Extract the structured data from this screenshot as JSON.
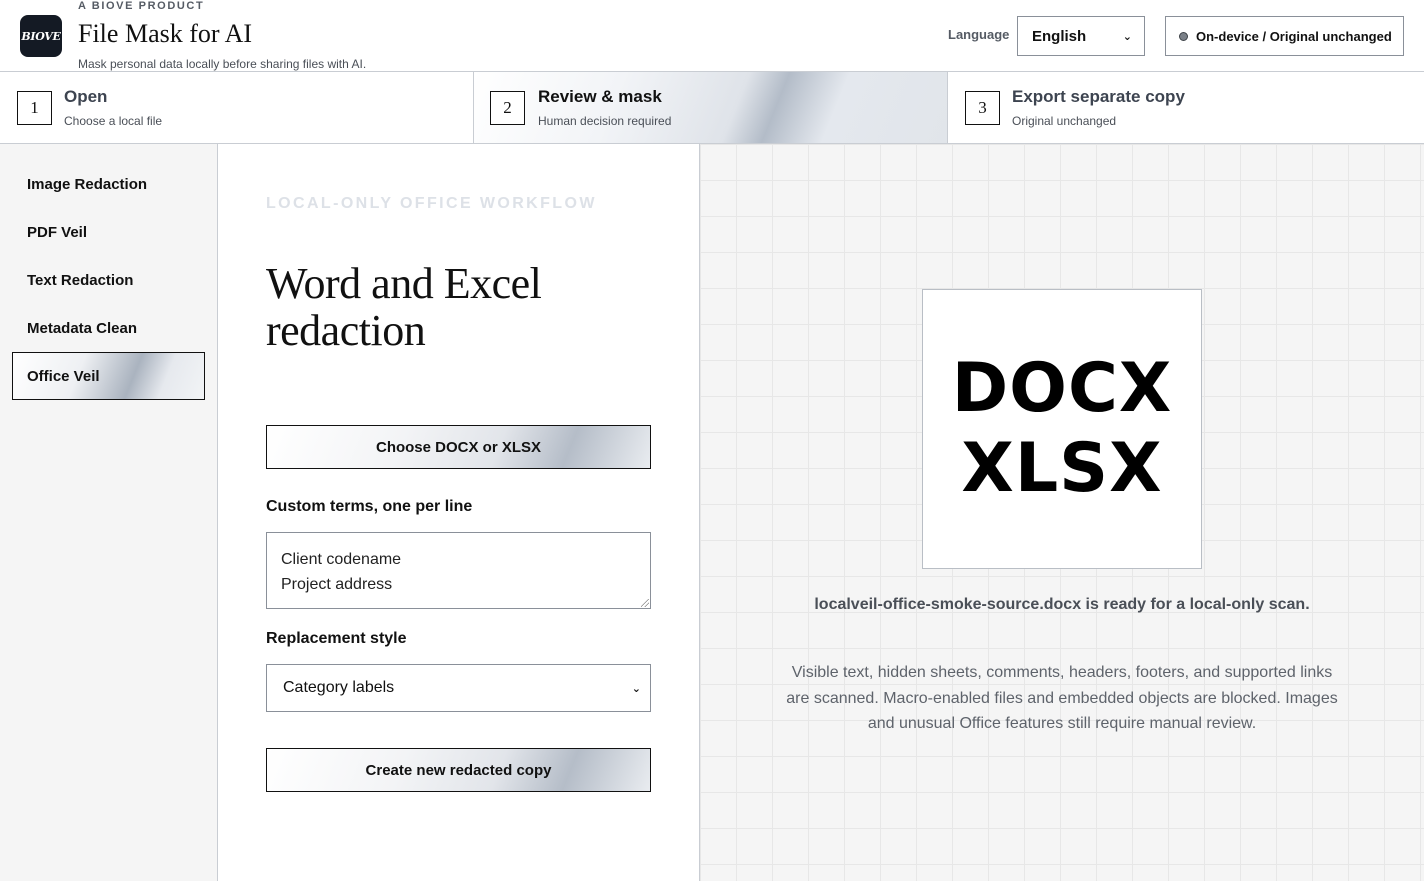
{
  "header": {
    "logo_text": "BIOVE",
    "kicker": "A BIOVE PRODUCT",
    "title": "File Mask for AI",
    "subtitle": "Mask personal data locally before sharing files with AI.",
    "language_label": "Language",
    "language_value": "English",
    "status": "On-device / Original unchanged"
  },
  "steps": [
    {
      "number": "1",
      "title": "Open",
      "subtitle": "Choose a local file"
    },
    {
      "number": "2",
      "title": "Review & mask",
      "subtitle": "Human decision required"
    },
    {
      "number": "3",
      "title": "Export separate copy",
      "subtitle": "Original unchanged"
    }
  ],
  "sidebar": {
    "items": [
      {
        "label": "Image Redaction"
      },
      {
        "label": "PDF Veil"
      },
      {
        "label": "Text Redaction"
      },
      {
        "label": "Metadata Clean"
      },
      {
        "label": "Office Veil"
      }
    ]
  },
  "form": {
    "eyebrow": "LOCAL-ONLY OFFICE WORKFLOW",
    "heading": "Word and Excel redaction",
    "choose_button": "Choose DOCX or XLSX",
    "custom_terms_label": "Custom terms, one per line",
    "custom_terms_lines": [
      "Client codename",
      "Project address"
    ],
    "replacement_label": "Replacement style",
    "replacement_value": "Category labels",
    "create_button": "Create new redacted copy"
  },
  "preview": {
    "card_line1": "DOCX",
    "card_line2": "XLSX",
    "ready_text": "localveil-office-smoke-source.docx is ready for a local-only scan.",
    "description": "Visible text, hidden sheets, comments, headers, footers, and supported links are scanned. Macro-enabled files and embedded objects are blocked. Images and unusual Office features still require manual review."
  }
}
